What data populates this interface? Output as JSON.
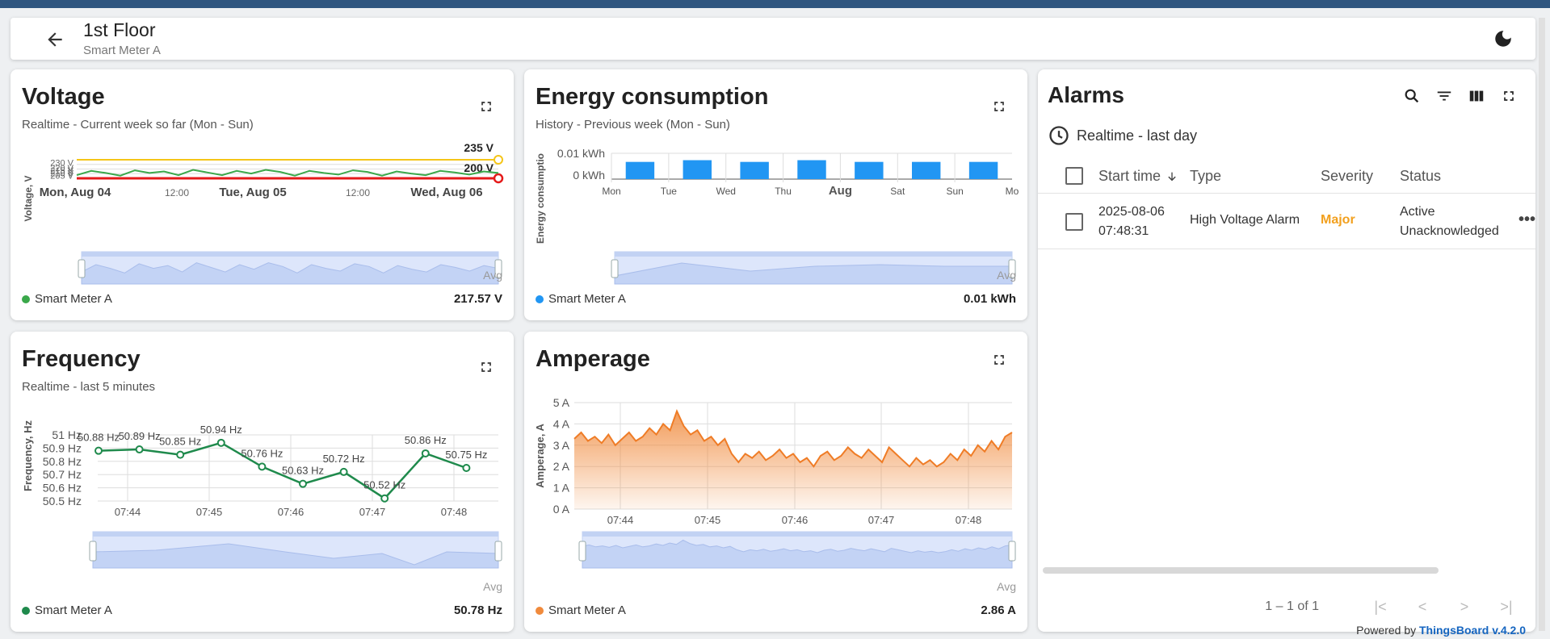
{
  "header": {
    "title": "1st Floor",
    "subtitle": "Smart Meter A"
  },
  "voltage": {
    "title": "Voltage",
    "subtitle": "Realtime - Current week so far (Mon - Sun)",
    "ylabel": "Voltage, V",
    "yticks": [
      "230 V",
      "220 V",
      "215 V",
      "210 V",
      "205 V"
    ],
    "xticks": [
      "Mon, Aug 04",
      "12:00",
      "Tue, Aug 05",
      "12:00",
      "Wed, Aug 06"
    ],
    "threshold_high": "235 V",
    "threshold_low": "200 V",
    "avg_label": "Avg",
    "legend": "Smart Meter A",
    "legend_value": "217.57 V",
    "color": "#3aa84a"
  },
  "energy": {
    "title": "Energy consumption",
    "subtitle": "History - Previous week (Mon - Sun)",
    "ylabel": "Energy consumptio",
    "yticks": [
      "0.01 kWh",
      "0 kWh"
    ],
    "avg_label": "Avg",
    "legend": "Smart Meter A",
    "legend_value": "0.01 kWh",
    "color": "#2196f3"
  },
  "frequency": {
    "title": "Frequency",
    "subtitle": "Realtime - last 5 minutes",
    "ylabel": "Frequency, Hz",
    "yticks": [
      "51 Hz",
      "50.9 Hz",
      "50.8 Hz",
      "50.7 Hz",
      "50.6 Hz",
      "50.5 Hz"
    ],
    "avg_label": "Avg",
    "legend": "Smart Meter A",
    "legend_value": "50.78 Hz",
    "color": "#1f8a4c"
  },
  "amperage": {
    "title": "Amperage",
    "subtitle": "",
    "ylabel": "Amperage, A",
    "yticks": [
      "5 A",
      "4 A",
      "3 A",
      "2 A",
      "1 A",
      "0 A"
    ],
    "xticks": [
      "07:44",
      "07:45",
      "07:46",
      "07:47",
      "07:48"
    ],
    "avg_label": "Avg",
    "legend": "Smart Meter A",
    "legend_value": "2.86 A",
    "color": "#f08a3c"
  },
  "alarms": {
    "title": "Alarms",
    "timewindow": "Realtime - last day",
    "columns": [
      "Start time",
      "Type",
      "Severity",
      "Status"
    ],
    "rows": [
      {
        "date": "2025-08-06",
        "time": "07:48:31",
        "type": "High Voltage Alarm",
        "severity": "Major",
        "status1": "Active",
        "status2": "Unacknowledged"
      }
    ],
    "pagination": "1 – 1 of 1",
    "severity_color": "#f2a01e"
  },
  "footer": {
    "powered_by": "Powered by",
    "brand": "ThingsBoard v.4.2.0"
  },
  "chart_data": [
    {
      "type": "line",
      "title": "Voltage",
      "ylabel": "Voltage, V",
      "x": [
        "Mon, Aug 04",
        "12:00",
        "Tue, Aug 05",
        "12:00",
        "Wed, Aug 06"
      ],
      "ylim": [
        200,
        235
      ],
      "series": [
        {
          "name": "Smart Meter A",
          "values": [
            206,
            214,
            210,
            205,
            215,
            210,
            213,
            206,
            216,
            211,
            206,
            214,
            209,
            216,
            212,
            205,
            214,
            210,
            207,
            215,
            212,
            205,
            213,
            209,
            206,
            214,
            211,
            207,
            213,
            210
          ]
        }
      ]
    },
    {
      "type": "bar",
      "title": "Energy consumption",
      "categories": [
        "Mon",
        "Tue",
        "Wed",
        "Thu",
        "Fri",
        "Sat",
        "Sun"
      ],
      "x_labels": [
        "Mon",
        "Tue",
        "Wed",
        "Thu",
        "Aug",
        "Sat",
        "Sun",
        "Mo"
      ],
      "ylim": [
        0,
        0.015
      ],
      "series": [
        {
          "name": "Smart Meter A",
          "values": [
            0.01,
            0.011,
            0.01,
            0.011,
            0.01,
            0.01,
            0.01
          ]
        }
      ]
    },
    {
      "type": "line",
      "title": "Frequency",
      "ylabel": "Frequency, Hz",
      "x": [
        "07:43:30",
        "07:44",
        "07:44:30",
        "07:45",
        "07:45:30",
        "07:46",
        "07:46:30",
        "07:47",
        "07:47:30",
        "07:48"
      ],
      "x_ticks": [
        "07:44",
        "07:45",
        "07:46",
        "07:47",
        "07:48"
      ],
      "ylim": [
        50.5,
        51
      ],
      "series": [
        {
          "name": "Smart Meter A",
          "values": [
            50.88,
            50.89,
            50.85,
            50.94,
            50.76,
            50.63,
            50.72,
            50.52,
            50.86,
            50.75
          ]
        }
      ],
      "data_labels": [
        "50.88 Hz",
        "50.89 Hz",
        "50.85 Hz",
        "50.94 Hz",
        "50.76 Hz",
        "50.63 Hz",
        "50.72 Hz",
        "50.52 Hz",
        "50.86 Hz",
        "50.75 Hz"
      ]
    },
    {
      "type": "area",
      "title": "Amperage",
      "ylabel": "Amperage, A",
      "x_ticks": [
        "07:44",
        "07:45",
        "07:46",
        "07:47",
        "07:48"
      ],
      "ylim": [
        0,
        5
      ],
      "series": [
        {
          "name": "Smart Meter A",
          "values": [
            3.3,
            3.6,
            3.2,
            3.4,
            3.1,
            3.5,
            3.0,
            3.3,
            3.6,
            3.2,
            3.4,
            3.8,
            3.5,
            4.0,
            3.7,
            4.6,
            3.9,
            3.5,
            3.7,
            3.2,
            3.4,
            3.0,
            3.3,
            2.6,
            2.2,
            2.6,
            2.4,
            2.7,
            2.3,
            2.5,
            2.8,
            2.4,
            2.6,
            2.2,
            2.4,
            2.0,
            2.5,
            2.7,
            2.3,
            2.5,
            2.9,
            2.6,
            2.4,
            2.8,
            2.5,
            2.2,
            2.9,
            2.6,
            2.3,
            2.0,
            2.4,
            2.1,
            2.3,
            2.0,
            2.2,
            2.6,
            2.3,
            2.8,
            2.5,
            3.0,
            2.7,
            3.2,
            2.8,
            3.4,
            3.6
          ]
        }
      ]
    }
  ]
}
